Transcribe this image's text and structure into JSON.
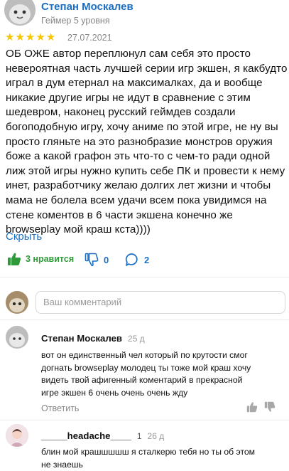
{
  "review": {
    "author": "Степан Москалев",
    "level": "Геймер 5 уровня",
    "rating": 5,
    "date": "27.07.2021",
    "lines": [
      "ОБ ОЖЕ автор переплюнул сам себя это просто",
      "невероятная часть лучшей серии игр экшен, я какбудто",
      "играл в дум етернал на максималках, да и вообще",
      "никакие другие игры не идут в сравнение с этим",
      "шедевром, наконец русский геймдев создали",
      "богоподобную игру, хочу аниме по этой игре, не ну вы",
      "просто гляньте на это разнобразие монстров оружия",
      "боже а какой графон эть что-то с чем-то ради одной",
      "лиж этой игры нужно купить себе ПК и провести к нему",
      "инет, разработчику желаю долгих лет жизни и чтобы",
      "мама не болела всем удачи всем пока увидимся на",
      "стене коментов в 6 части экшена конечно же",
      "browseplay мой краш кста))))"
    ],
    "collapse_label": "Скрыть",
    "likes_label": "3 нравится",
    "dislikes": "0",
    "comments_count": "2"
  },
  "comment_input": {
    "placeholder": "Ваш комментарий"
  },
  "replies": [
    {
      "author": "Степан Москалев",
      "age": "25 д",
      "lines": [
        "вот он единственный чел который по крутости смог",
        "догнать browseplay молодец ты тоже мой краш хочу",
        "видеть твой афигенный коментарий в прекрасной",
        "игре экшен 6 очень очень очень жду"
      ],
      "reply_label": "Ответить"
    },
    {
      "author": "_____headache____",
      "score": "1",
      "age": "26 д",
      "lines": [
        "блин мой крашшшшш я сталкерю тебя но ты об этом",
        "не знаешь"
      ]
    }
  ],
  "colors": {
    "link_blue": "#1a6fc4",
    "like_green": "#2e9a3a",
    "star_gold": "#f7c600",
    "muted": "#888888"
  },
  "icons": [
    "thumbs-up-icon",
    "thumbs-down-icon",
    "comment-icon",
    "star-icon"
  ]
}
